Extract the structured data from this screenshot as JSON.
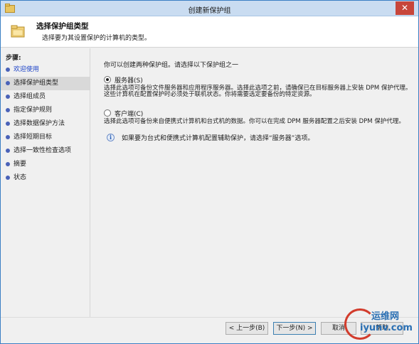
{
  "window": {
    "title": "创建新保护组",
    "close_glyph": "✕"
  },
  "header": {
    "title": "选择保护组类型",
    "subtitle": "选择要为其设置保护的计算机的类型。"
  },
  "sidebar": {
    "steps_title": "步骤:",
    "items": [
      {
        "label": "欢迎使用",
        "state": "done"
      },
      {
        "label": "选择保护组类型",
        "state": "current"
      },
      {
        "label": "选择组成员",
        "state": "pending"
      },
      {
        "label": "指定保护规则",
        "state": "pending"
      },
      {
        "label": "选择数据保护方法",
        "state": "pending"
      },
      {
        "label": "选择短期目标",
        "state": "pending"
      },
      {
        "label": "选择一致性检查选项",
        "state": "pending"
      },
      {
        "label": "摘要",
        "state": "pending"
      },
      {
        "label": "状态",
        "state": "pending"
      }
    ]
  },
  "main": {
    "intro": "你可以创建两种保护组。请选择以下保护组之一",
    "options": [
      {
        "label": "服务器(S)",
        "selected": true,
        "description": "选择此选项可备份文件服务器和应用程序服务器。选择此选项之前，请确保已在目标服务器上安装 DPM 保护代理。这些计算机在配置保护时必须处于联机状态。你将需要选定要备份的特定资源。"
      },
      {
        "label": "客户端(C)",
        "selected": false,
        "description": "选择此选项可备份来自便携式计算机和台式机的数据。你可以在完成 DPM 服务器配置之后安装 DPM 保护代理。"
      }
    ],
    "info": "如果要为台式和便携式计算机配置辅助保护，请选择“服务器”选项。",
    "info_glyph": "i"
  },
  "footer": {
    "back": "< 上一步(B)",
    "next": "下一步(N) >",
    "cancel": "取消",
    "help": "帮助"
  },
  "watermark": {
    "name": "运维网",
    "url": "iyunv.com"
  },
  "colors": {
    "accent": "#1c43c8",
    "step_dot": "#4a62b8",
    "close_button": "#c7463b",
    "watermark_red": "#d23c2c",
    "watermark_blue": "#2a6fb3"
  }
}
